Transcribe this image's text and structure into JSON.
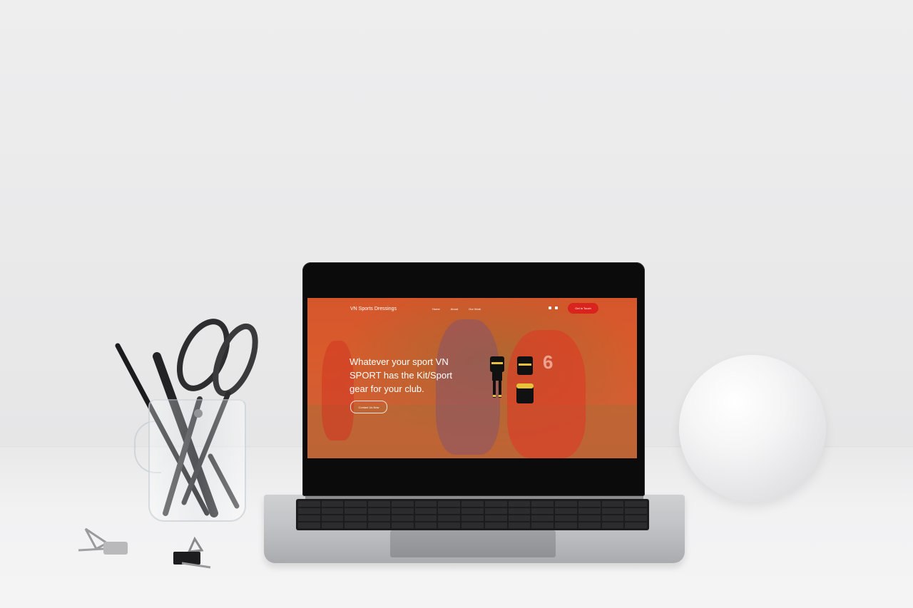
{
  "website": {
    "logo": "VN Sports Dressings",
    "nav_links": [
      "Home",
      "About",
      "Our Work"
    ],
    "cta_label": "Get in Touch",
    "hero_line1": "Whatever your sport VN",
    "hero_line2": "SPORT has the Kit/Sport",
    "hero_line3": "gear for your club.",
    "hero_button": "Contact Us Now",
    "jersey_number": "6"
  },
  "colors": {
    "overlay": "#e2502a",
    "cta": "#d8241c",
    "wall": "#eeeeef"
  }
}
